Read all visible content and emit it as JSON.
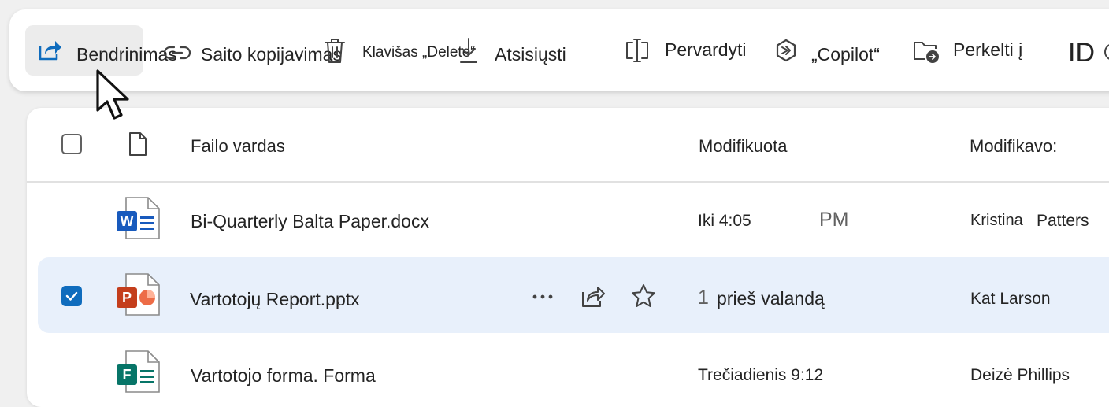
{
  "toolbar": {
    "share_label": "Bendrinimas",
    "copy_link_label": "Saito kopijavimas",
    "delete_label": "Klavišas „Delete“",
    "download_label": "Atsisiųsti",
    "rename_label": "Pervardyti",
    "copilot_label": "„Copilot“",
    "move_label": "Perkelti į",
    "overflow_label": "ID"
  },
  "list": {
    "columns": {
      "name": "Failo vardas",
      "modified": "Modifikuota",
      "modified_by": "Modifikavo:"
    },
    "rows": [
      {
        "name": "Bi-Quarterly Balta Paper.docx",
        "modified": "Iki 4:05",
        "modified_suffix": "PM",
        "modified_by_first": "Kristina",
        "modified_by_last": "Patters",
        "icon": "word-file-icon",
        "icon_letter": "W",
        "selected": false
      },
      {
        "name": "Vartotojų Report.pptx",
        "modified_prefix": "1",
        "modified": "prieš valandą",
        "modified_by": "Kat Larson",
        "icon": "powerpoint-file-icon",
        "icon_letter": "P",
        "selected": true
      },
      {
        "name": "Vartotojo forma. Forma",
        "modified": "Trečiadienis 9:12",
        "modified_by": "Deizė Phillips",
        "icon": "forms-file-icon",
        "icon_letter": "F",
        "selected": false
      }
    ]
  },
  "colors": {
    "accent": "#0f6cbd",
    "word": "#185abd",
    "powerpoint": "#c43e1c",
    "forms": "#077568",
    "selected_row": "#e8f0fb"
  }
}
